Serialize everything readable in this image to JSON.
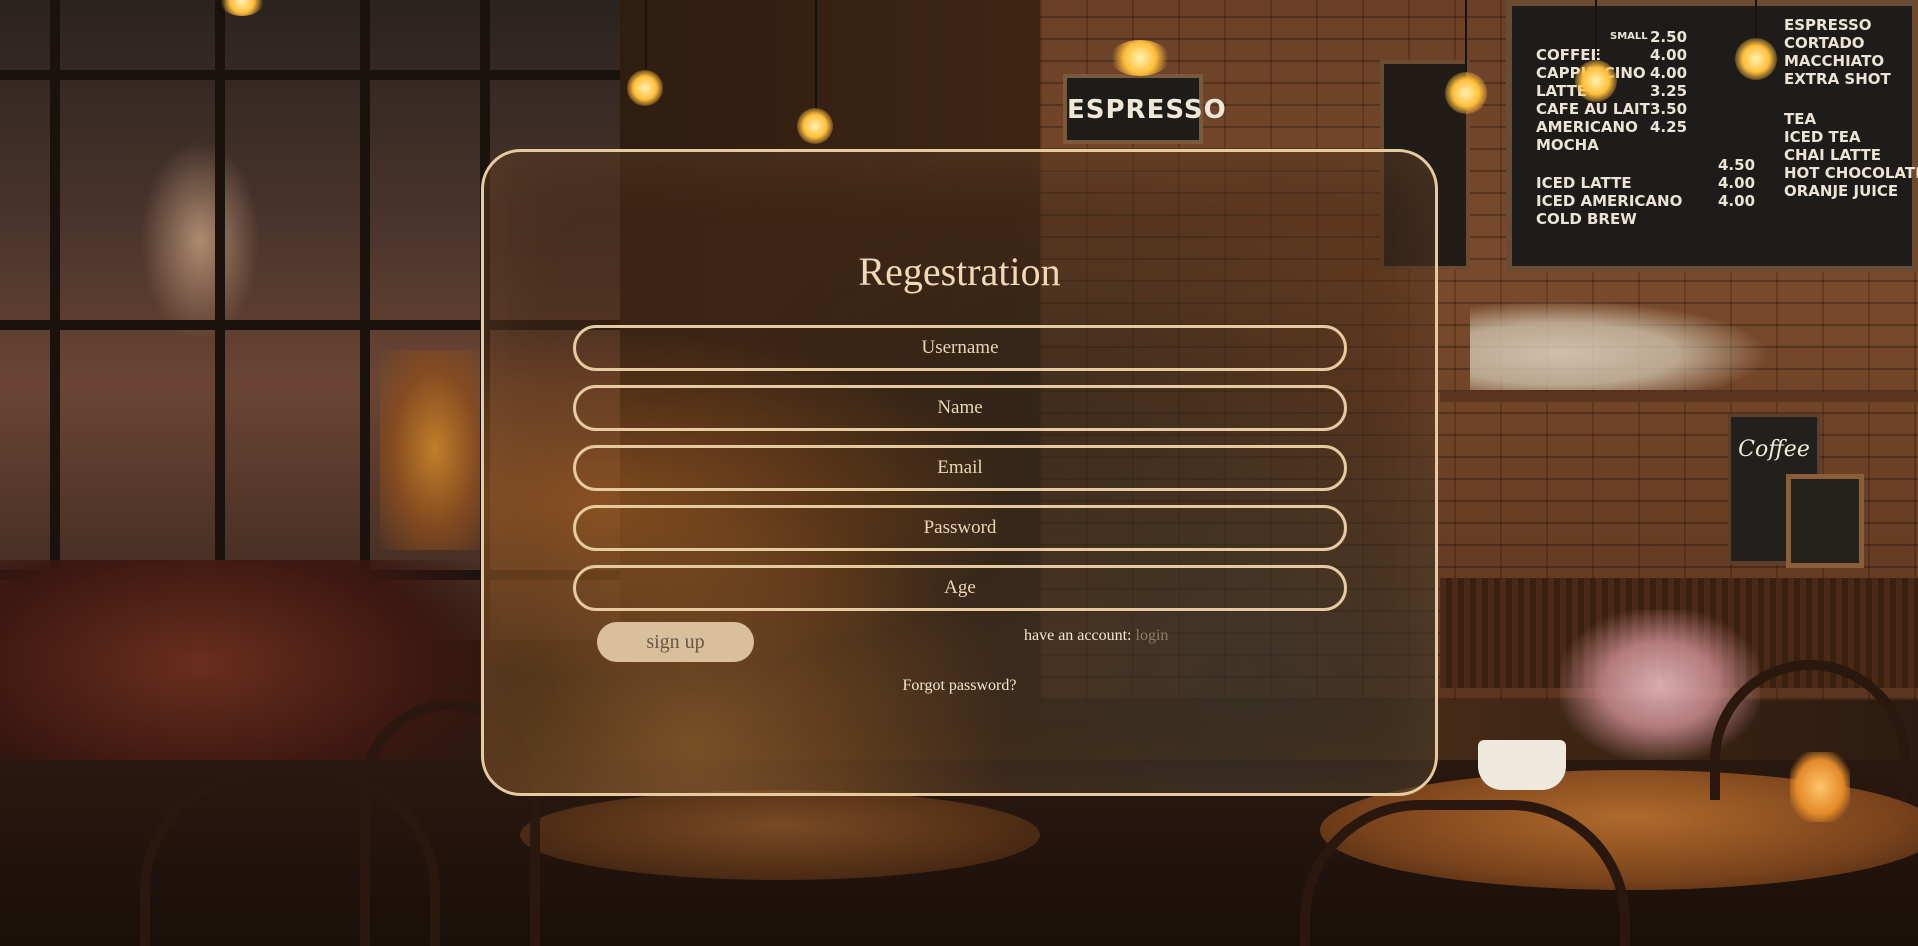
{
  "background": {
    "espresso_sign": "ESPRESSO",
    "coffee_sign": "Coffee",
    "menu_board": {
      "header_small": "SMALL",
      "lines_left": [
        "COFFEE",
        "CAPPUCCINO",
        "LATTE",
        "CAFE AU LAIT",
        "AMERICANO",
        "MOCHA"
      ],
      "prices_left": [
        "2.50",
        "4.00",
        "4.00",
        "3.25",
        "3.50",
        "4.25"
      ],
      "lines_right": [
        "ESPRESSO",
        "CORTADO",
        "MACCHIATO",
        "EXTRA SHOT"
      ],
      "lines_left_2": [
        "ICED LATTE",
        "ICED AMERICANO",
        "COLD BREW"
      ],
      "prices_left_2": [
        "4.50",
        "4.00",
        "4.00"
      ],
      "lines_right_2": [
        "TEA",
        "ICED TEA",
        "CHAI LATTE",
        "HOT CHOCOLATE",
        "ORANJE JUICE"
      ]
    }
  },
  "form": {
    "title": "Regestration",
    "fields": {
      "username_placeholder": "Username",
      "name_placeholder": "Name",
      "email_placeholder": "Email",
      "password_placeholder": "Password",
      "age_placeholder": "Age"
    },
    "signup_label": "sign up",
    "have_account_text": "have an account:",
    "login_link": "login",
    "forgot_password": "Forgot password?"
  },
  "colors": {
    "card_border": "#e7cba0",
    "title_text": "#f1d9b5",
    "button_bg": "#d9bf9c",
    "button_text": "#6b5646",
    "login_link": "#8f7b6a"
  }
}
